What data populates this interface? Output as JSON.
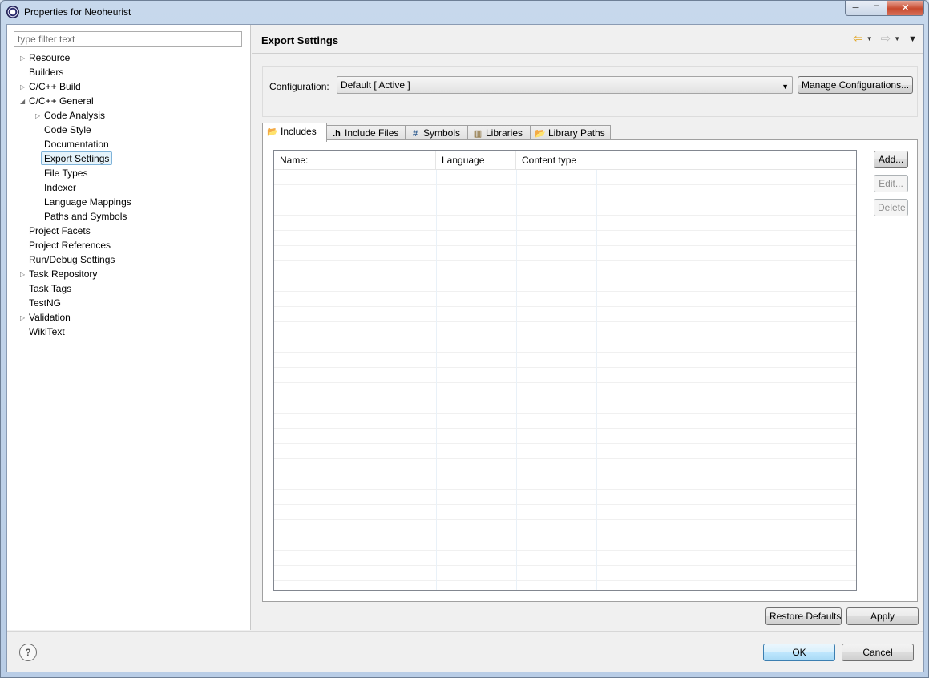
{
  "window": {
    "title": "Properties for Neoheurist",
    "controls": {
      "minimize": "─",
      "maximize": "□",
      "close": "✕"
    }
  },
  "filter": {
    "placeholder": "type filter text",
    "value": ""
  },
  "tree": {
    "items": [
      {
        "label": "Resource",
        "level": 0,
        "expander": "collapsed"
      },
      {
        "label": "Builders",
        "level": 0,
        "expander": "none"
      },
      {
        "label": "C/C++ Build",
        "level": 0,
        "expander": "collapsed"
      },
      {
        "label": "C/C++ General",
        "level": 0,
        "expander": "expanded"
      },
      {
        "label": "Code Analysis",
        "level": 1,
        "expander": "collapsed"
      },
      {
        "label": "Code Style",
        "level": 1,
        "expander": "none"
      },
      {
        "label": "Documentation",
        "level": 1,
        "expander": "none"
      },
      {
        "label": "Export Settings",
        "level": 1,
        "expander": "none",
        "selected": true
      },
      {
        "label": "File Types",
        "level": 1,
        "expander": "none"
      },
      {
        "label": "Indexer",
        "level": 1,
        "expander": "none"
      },
      {
        "label": "Language Mappings",
        "level": 1,
        "expander": "none"
      },
      {
        "label": "Paths and Symbols",
        "level": 1,
        "expander": "none"
      },
      {
        "label": "Project Facets",
        "level": 0,
        "expander": "none"
      },
      {
        "label": "Project References",
        "level": 0,
        "expander": "none"
      },
      {
        "label": "Run/Debug Settings",
        "level": 0,
        "expander": "none"
      },
      {
        "label": "Task Repository",
        "level": 0,
        "expander": "collapsed"
      },
      {
        "label": "Task Tags",
        "level": 0,
        "expander": "none"
      },
      {
        "label": "TestNG",
        "level": 0,
        "expander": "none"
      },
      {
        "label": "Validation",
        "level": 0,
        "expander": "collapsed"
      },
      {
        "label": "WikiText",
        "level": 0,
        "expander": "none"
      }
    ]
  },
  "page": {
    "title": "Export Settings",
    "nav": {
      "back": "⇦",
      "forward": "⇨",
      "dropdown": "▼",
      "menu": "▼"
    }
  },
  "configuration": {
    "label": "Configuration:",
    "selected": "Default  [ Active ]",
    "manage_label": "Manage Configurations..."
  },
  "tabs": [
    {
      "label": "Includes",
      "icon": "includes-folder-icon",
      "active": true
    },
    {
      "label": "Include Files",
      "icon": "header-file-icon",
      "active": false
    },
    {
      "label": "Symbols",
      "icon": "hash-icon",
      "active": false
    },
    {
      "label": "Libraries",
      "icon": "library-icon",
      "active": false
    },
    {
      "label": "Library Paths",
      "icon": "library-path-icon",
      "active": false
    }
  ],
  "table": {
    "columns": [
      "Name:",
      "Language",
      "Content type",
      ""
    ],
    "rows": []
  },
  "side_buttons": {
    "add": "Add...",
    "edit": "Edit...",
    "delete": "Delete"
  },
  "page_buttons": {
    "restore": "Restore Defaults",
    "apply": "Apply"
  },
  "dialog_buttons": {
    "ok": "OK",
    "cancel": "Cancel"
  },
  "help": {
    "symbol": "?"
  }
}
